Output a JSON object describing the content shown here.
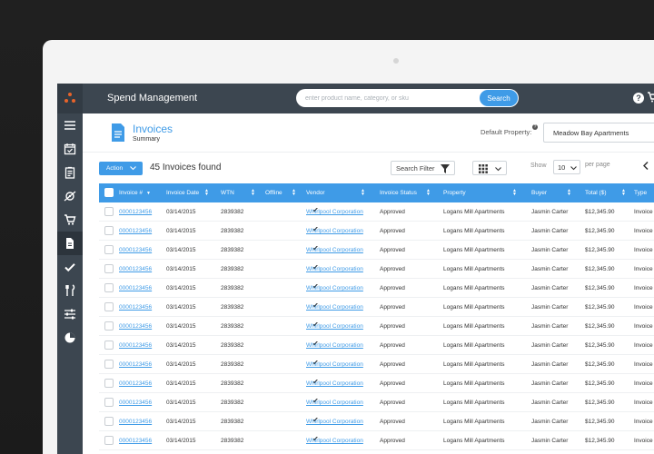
{
  "app": {
    "title": "Spend Management"
  },
  "search": {
    "placeholder": "enter product name, category, or sku",
    "button": "Search"
  },
  "header": {
    "help_icon": "help-icon",
    "cart_icon": "cart-icon"
  },
  "sidebar": {
    "items": [
      {
        "icon": "menu-icon"
      },
      {
        "icon": "calendar-check-icon"
      },
      {
        "icon": "clipboard-icon"
      },
      {
        "icon": "tag-icon"
      },
      {
        "icon": "cart-icon"
      },
      {
        "icon": "document-icon",
        "active": true
      },
      {
        "icon": "check-icon"
      },
      {
        "icon": "tools-icon"
      },
      {
        "icon": "sliders-icon"
      },
      {
        "icon": "pie-chart-icon"
      }
    ]
  },
  "page": {
    "title": "Invoices",
    "subtitle": "Summary"
  },
  "default_property": {
    "label": "Default Property:",
    "value": "Meadow Bay Apartments"
  },
  "toolbar": {
    "action": "Action",
    "found": "45 Invoices found",
    "filter": "Search Filter",
    "show_label": "Show",
    "show_value": "10",
    "per_page": "per page"
  },
  "table": {
    "columns": [
      "Invoice #",
      "Invoice Date",
      "WTN",
      "Offline",
      "Vendor",
      "Invoice Status",
      "Property",
      "Buyer",
      "Total ($)",
      "Type"
    ],
    "rows": [
      [
        "0000123456",
        "03/14/2015",
        "2839382",
        "✔",
        "Whirlpool Corporation",
        "Approved",
        "Logans Mill Apartments",
        "Jasmin Carter",
        "$12,345.90",
        "Invoice"
      ],
      [
        "0000123456",
        "03/14/2015",
        "2839382",
        "✔",
        "Whirlpool Corporation",
        "Approved",
        "Logans Mill Apartments",
        "Jasmin Carter",
        "$12,345.90",
        "Invoice"
      ],
      [
        "0000123456",
        "03/14/2015",
        "2839382",
        "✔",
        "Whirlpool Corporation",
        "Approved",
        "Logans Mill Apartments",
        "Jasmin Carter",
        "$12,345.90",
        "Invoice"
      ],
      [
        "0000123456",
        "03/14/2015",
        "2839382",
        "✔",
        "Whirlpool Corporation",
        "Approved",
        "Logans Mill Apartments",
        "Jasmin Carter",
        "$12,345.90",
        "Invoice"
      ],
      [
        "0000123456",
        "03/14/2015",
        "2839382",
        "✔",
        "Whirlpool Corporation",
        "Approved",
        "Logans Mill Apartments",
        "Jasmin Carter",
        "$12,345.90",
        "Invoice"
      ],
      [
        "0000123456",
        "03/14/2015",
        "2839382",
        "✔",
        "Whirlpool Corporation",
        "Approved",
        "Logans Mill Apartments",
        "Jasmin Carter",
        "$12,345.90",
        "Invoice"
      ],
      [
        "0000123456",
        "03/14/2015",
        "2839382",
        "✔",
        "Whirlpool Corporation",
        "Approved",
        "Logans Mill Apartments",
        "Jasmin Carter",
        "$12,345.90",
        "Invoice"
      ],
      [
        "0000123456",
        "03/14/2015",
        "2839382",
        "✔",
        "Whirlpool Corporation",
        "Approved",
        "Logans Mill Apartments",
        "Jasmin Carter",
        "$12,345.90",
        "Invoice"
      ],
      [
        "0000123456",
        "03/14/2015",
        "2839382",
        "✔",
        "Whirlpool Corporation",
        "Approved",
        "Logans Mill Apartments",
        "Jasmin Carter",
        "$12,345.90",
        "Invoice"
      ],
      [
        "0000123456",
        "03/14/2015",
        "2839382",
        "✔",
        "Whirlpool Corporation",
        "Approved",
        "Logans Mill Apartments",
        "Jasmin Carter",
        "$12,345.90",
        "Invoice"
      ],
      [
        "0000123456",
        "03/14/2015",
        "2839382",
        "✔",
        "Whirlpool Corporation",
        "Approved",
        "Logans Mill Apartments",
        "Jasmin Carter",
        "$12,345.90",
        "Invoice"
      ],
      [
        "0000123456",
        "03/14/2015",
        "2839382",
        "✔",
        "Whirlpool Corporation",
        "Approved",
        "Logans Mill Apartments",
        "Jasmin Carter",
        "$12,345.90",
        "Invoice"
      ],
      [
        "0000123456",
        "03/14/2015",
        "2839382",
        "✔",
        "Whirlpool Corporation",
        "Approved",
        "Logans Mill Apartments",
        "Jasmin Carter",
        "$12,345.90",
        "Invoice"
      ]
    ]
  },
  "colors": {
    "accent": "#3f9be7",
    "topbar": "#3c4650",
    "logo": "#e8632a"
  }
}
